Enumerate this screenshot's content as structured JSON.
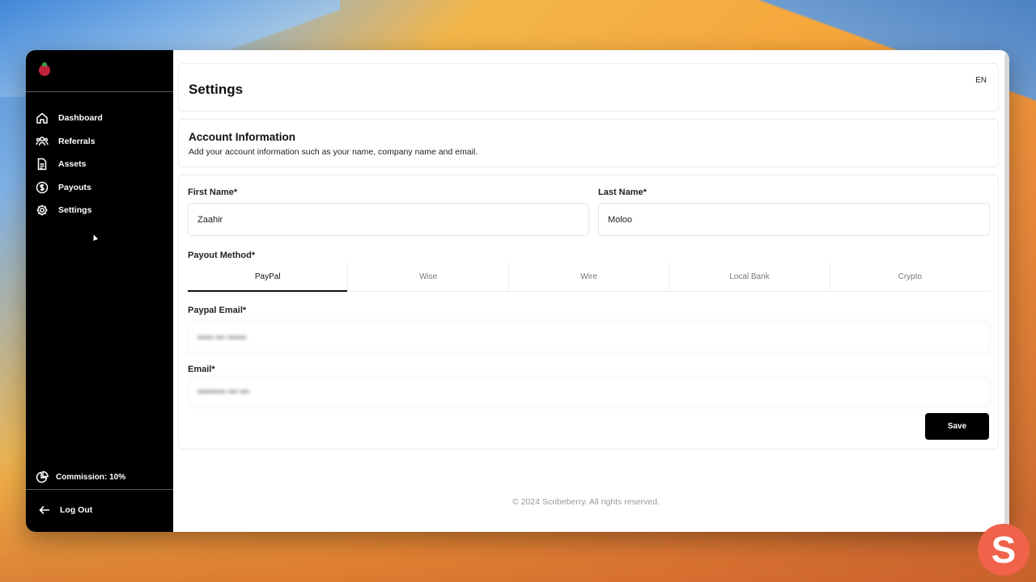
{
  "colors": {
    "sidebar_bg": "#000000",
    "accent": "#000000",
    "brand_badge": "#f0624a"
  },
  "sidebar": {
    "items": [
      {
        "label": "Dashboard",
        "icon": "home-icon"
      },
      {
        "label": "Referrals",
        "icon": "users-icon"
      },
      {
        "label": "Assets",
        "icon": "document-icon"
      },
      {
        "label": "Payouts",
        "icon": "dollar-icon"
      },
      {
        "label": "Settings",
        "icon": "gear-icon"
      }
    ],
    "commission": "Commission: 10%",
    "logout": "Log Out"
  },
  "header": {
    "title": "Settings",
    "language": "EN"
  },
  "account": {
    "title": "Account Information",
    "subtitle": "Add your account information such as your name, company name and email."
  },
  "form": {
    "first_name_label": "First Name*",
    "first_name_value": "Zaahir",
    "last_name_label": "Last Name*",
    "last_name_value": "Moloo",
    "payout_label": "Payout Method*",
    "payout_tabs": [
      "PayPal",
      "Wise",
      "Wire",
      "Local Bank",
      "Crypto"
    ],
    "payout_selected": "PayPal",
    "paypal_email_label": "Paypal Email*",
    "paypal_email_value": "••••• ••• ••••••",
    "email_label": "Email*",
    "email_value": "••••••••• ••• •••",
    "save_label": "Save"
  },
  "footer": {
    "copyright": "© 2024 Scribeberry. All rights reserved."
  },
  "brand_badge": "S"
}
